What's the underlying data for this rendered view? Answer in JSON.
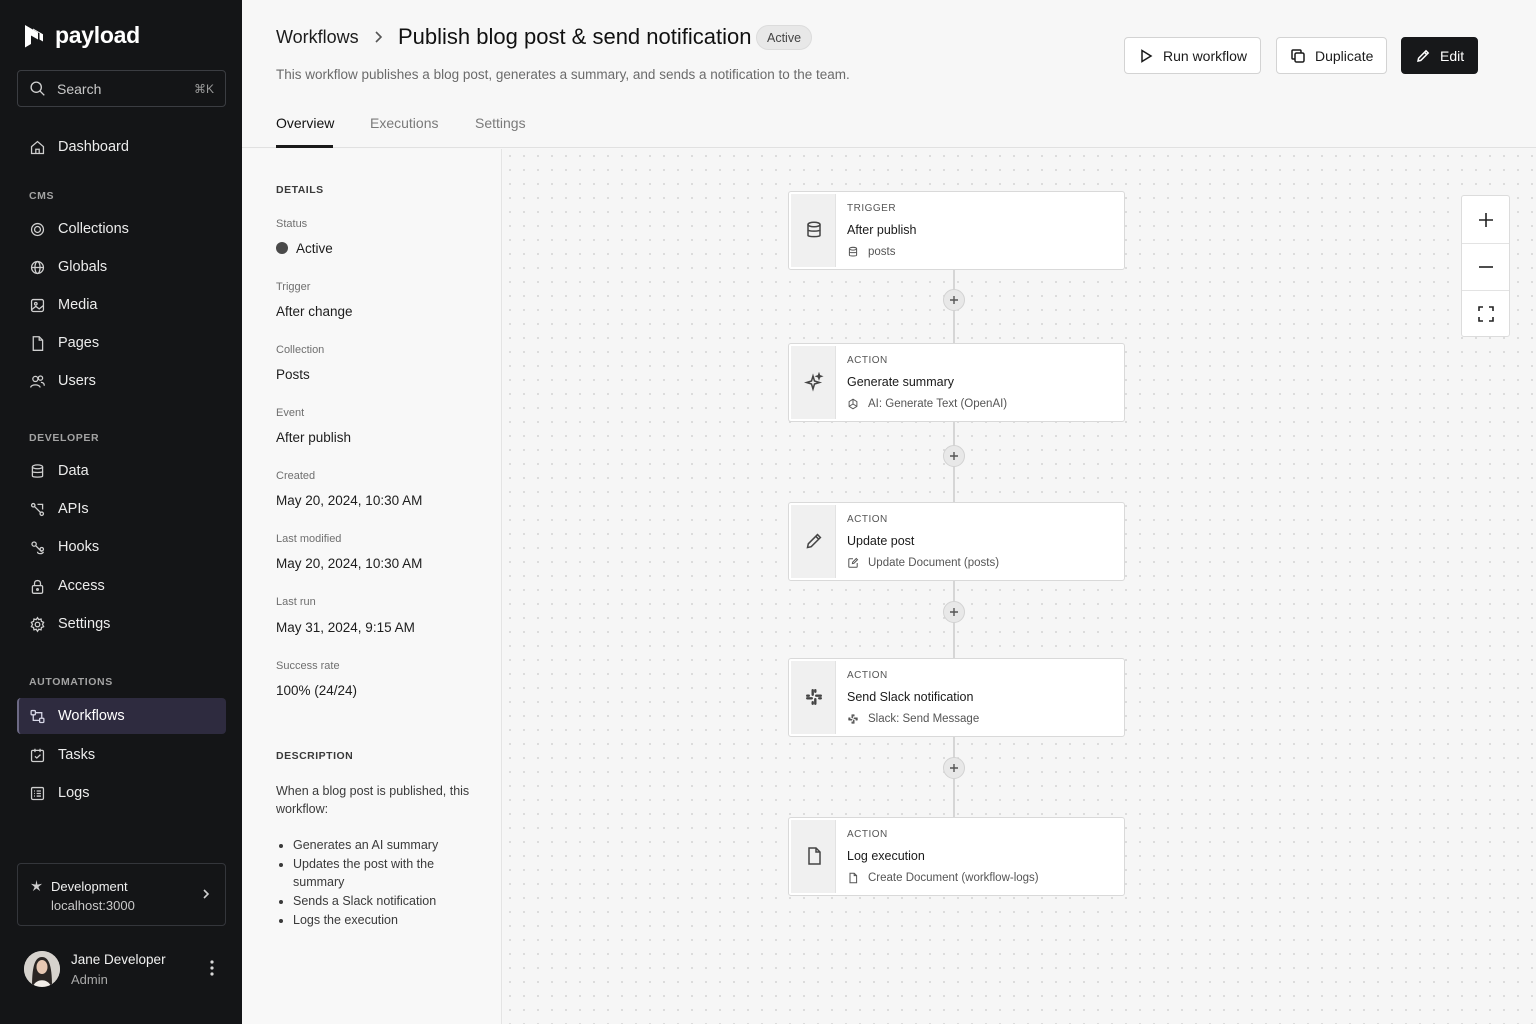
{
  "brand": {
    "name": "payload"
  },
  "search": {
    "placeholder": "Search",
    "shortcut": "⌘K"
  },
  "sidebar": {
    "dashboard": "Dashboard",
    "sections": {
      "cms": "CMS",
      "developer": "DEVELOPER",
      "automations": "AUTOMATIONS"
    },
    "cms_items": [
      {
        "label": "Collections",
        "icon": "collections-icon"
      },
      {
        "label": "Globals",
        "icon": "globe-icon"
      },
      {
        "label": "Media",
        "icon": "media-icon"
      },
      {
        "label": "Pages",
        "icon": "page-icon"
      },
      {
        "label": "Users",
        "icon": "users-icon"
      }
    ],
    "developer_items": [
      {
        "label": "Data",
        "icon": "database-icon"
      },
      {
        "label": "APIs",
        "icon": "api-icon"
      },
      {
        "label": "Hooks",
        "icon": "hook-icon"
      },
      {
        "label": "Access",
        "icon": "lock-icon"
      },
      {
        "label": "Settings",
        "icon": "gear-icon"
      }
    ],
    "automation_items": [
      {
        "label": "Workflows",
        "icon": "workflow-icon",
        "active": true
      },
      {
        "label": "Tasks",
        "icon": "tasks-icon"
      },
      {
        "label": "Logs",
        "icon": "logs-icon"
      }
    ],
    "environment": {
      "name": "Development",
      "host": "localhost:3000"
    },
    "user": {
      "name": "Jane Developer",
      "role": "Admin"
    }
  },
  "header": {
    "breadcrumb": "Workflows",
    "title": "Publish blog post & send notification",
    "status": "Active",
    "description": "This workflow publishes a blog post, generates a summary, and sends a notification to the team.",
    "buttons": {
      "run": "Run workflow",
      "duplicate": "Duplicate",
      "edit": "Edit"
    }
  },
  "tabs": [
    "Overview",
    "Executions",
    "Settings"
  ],
  "details": {
    "heading": "DETAILS",
    "fields": [
      {
        "label": "Status",
        "value": "Active"
      },
      {
        "label": "Trigger",
        "value": "After change"
      },
      {
        "label": "Collection",
        "value": "Posts"
      },
      {
        "label": "Event",
        "value": "After publish"
      },
      {
        "label": "Created",
        "value": "May 20, 2024, 10:30 AM"
      },
      {
        "label": "Last modified",
        "value": "May 20, 2024, 10:30 AM"
      },
      {
        "label": "Last run",
        "value": "May 31, 2024, 9:15 AM"
      },
      {
        "label": "Success rate",
        "value": "100% (24/24)"
      }
    ],
    "description_heading": "DESCRIPTION",
    "description_intro": "When a blog post is published, this workflow:",
    "description_steps": [
      "Generates an AI summary",
      "Updates the post with the summary",
      "Sends a Slack notification",
      "Logs the execution"
    ]
  },
  "nodes": [
    {
      "kind": "TRIGGER",
      "title": "After publish",
      "sub": "posts",
      "icon": "database-icon",
      "sub_icon": "database-icon"
    },
    {
      "kind": "ACTION",
      "title": "Generate summary",
      "sub": "AI: Generate Text (OpenAI)",
      "icon": "sparkle-icon",
      "sub_icon": "openai-icon"
    },
    {
      "kind": "ACTION",
      "title": "Update post",
      "sub": "Update Document (posts)",
      "icon": "pencil-icon",
      "sub_icon": "edit-doc-icon"
    },
    {
      "kind": "ACTION",
      "title": "Send Slack notification",
      "sub": "Slack: Send Message",
      "icon": "slack-icon",
      "sub_icon": "slack-icon"
    },
    {
      "kind": "ACTION",
      "title": "Log execution",
      "sub": "Create Document (workflow-logs)",
      "icon": "document-icon",
      "sub_icon": "document-icon"
    }
  ],
  "colors": {
    "sidebar_bg": "#141517",
    "active_nav": "#2e2b3f",
    "primary_button": "#17181a",
    "canvas_bg": "#f6f6f6"
  }
}
